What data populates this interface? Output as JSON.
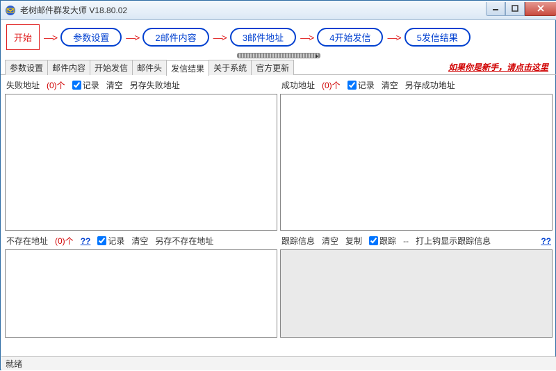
{
  "window": {
    "title": "老树邮件群发大师 V18.80.02"
  },
  "workflow": {
    "start": "开始",
    "steps": [
      "参数设置",
      "2邮件内容",
      "3邮件地址",
      "4开始发信",
      "5发信结果"
    ]
  },
  "tabs": {
    "items": [
      "参数设置",
      "邮件内容",
      "开始发信",
      "邮件头",
      "发信结果",
      "关于系统",
      "官方更新"
    ],
    "newbie": "如果你是新手，请点击这里"
  },
  "panes": {
    "fail": {
      "title": "失败地址",
      "count": "(0)个",
      "record": "记录",
      "clear": "清空",
      "save": "另存失败地址"
    },
    "success": {
      "title": "成功地址",
      "count": "(0)个",
      "record": "记录",
      "clear": "清空",
      "save": "另存成功地址"
    },
    "notexist": {
      "title": "不存在地址",
      "count": "(0)个",
      "help": "??",
      "record": "记录",
      "clear": "清空",
      "save": "另存不存在地址"
    },
    "trace": {
      "title": "跟踪信息",
      "clear": "清空",
      "copy": "复制",
      "track": "跟踪",
      "dash": "--",
      "hint": "打上钩显示跟踪信息",
      "help": "??"
    }
  },
  "status": {
    "text": "就绪"
  }
}
